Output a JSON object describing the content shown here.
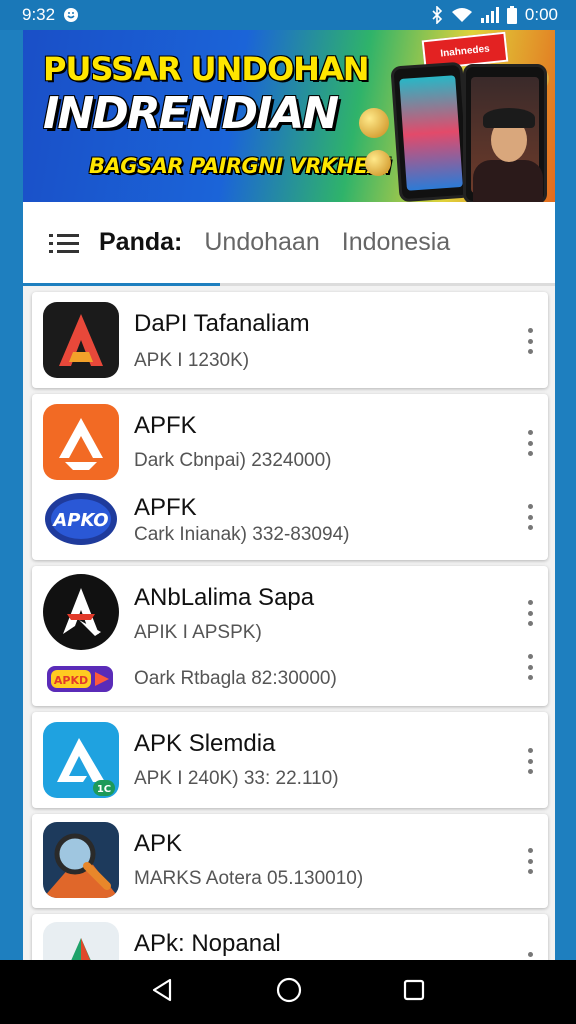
{
  "status_bar": {
    "time_left": "9:32",
    "time_right": "0:00",
    "icons": [
      "notification-icon",
      "bluetooth-icon",
      "wifi-icon",
      "signal-icon",
      "battery-icon"
    ]
  },
  "banner": {
    "line1": "PUSSAR UNDOHAN",
    "line2": "INDRENDIAN",
    "line3": "BAGSAR PAIRGNI VRKHEAI",
    "badge": "Inahnedes"
  },
  "tabs": [
    {
      "label": "Panda:",
      "active": true
    },
    {
      "label": "Undohaan",
      "active": false
    },
    {
      "label": "Indonesia",
      "active": false
    }
  ],
  "apps": [
    {
      "title": "DaPI Tafanaliam",
      "subtitle": "APK I 1230K)",
      "icon": "red-a-icon"
    },
    {
      "title": "APFK",
      "subtitle": "Dark Cbnpai) 2324000)",
      "icon": "orange-arrow-icon"
    },
    {
      "title": "APFK",
      "subtitle": "Cark Inianak) 332-83094)",
      "icon": "apko-logo-icon",
      "icon_text": "APKO"
    },
    {
      "title": "ANbLalima Sapa",
      "subtitle": "APIK I APSPK)",
      "icon": "black-plane-icon"
    },
    {
      "title": "",
      "subtitle": "Oark Rtbagla 82:30000)",
      "icon": "ticket-logo-icon",
      "icon_text": "APKD"
    },
    {
      "title": "APK Slemdia",
      "subtitle": "APK I 240K) 33: 22.110)",
      "icon": "blue-a-icon",
      "icon_badge": "1C"
    },
    {
      "title": "APK",
      "subtitle": "MARKS Aotera 05.130010)",
      "icon": "magnifier-icon"
    },
    {
      "title": "APk: Nopanal",
      "subtitle": "",
      "icon": "green-a-icon"
    }
  ],
  "nav_bar": {
    "icons": [
      "back-icon",
      "home-icon",
      "recents-icon"
    ]
  },
  "colors": {
    "accent": "#1e7fbf",
    "background": "#f2f2f2"
  }
}
